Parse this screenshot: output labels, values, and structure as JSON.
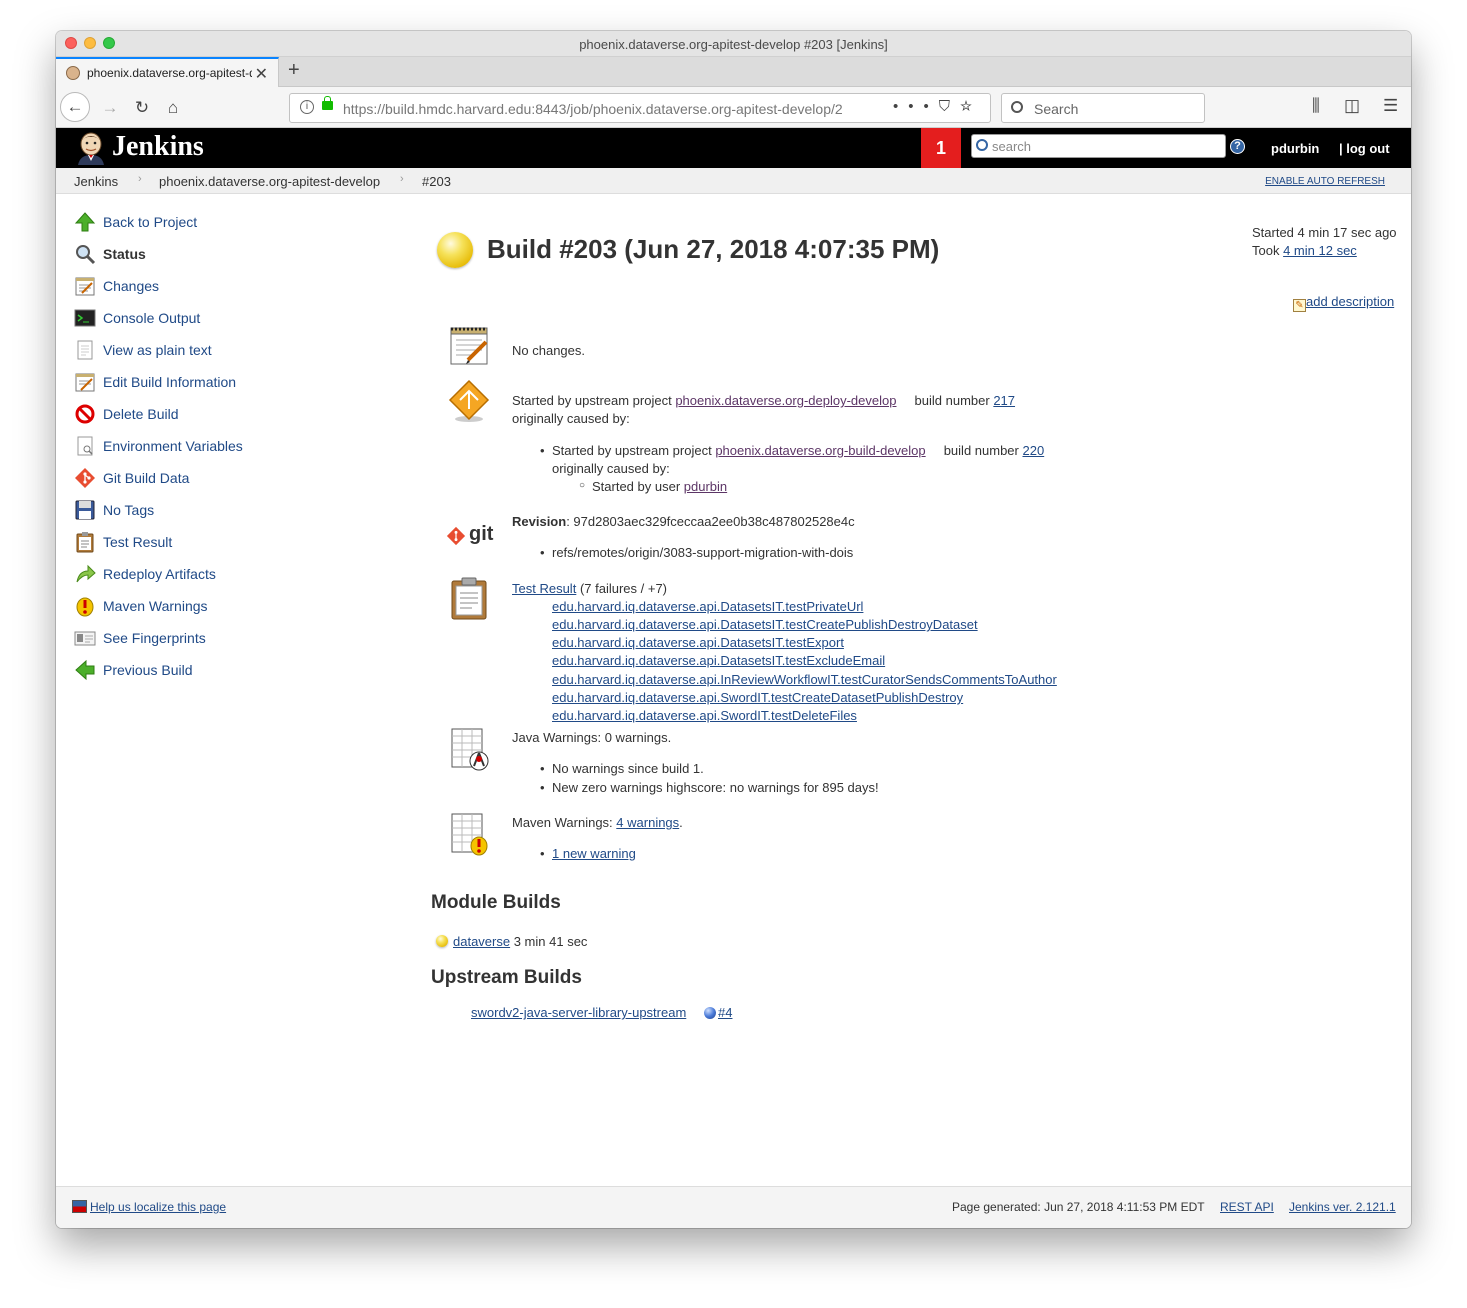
{
  "window": {
    "title": "phoenix.dataverse.org-apitest-develop #203 [Jenkins]"
  },
  "browser": {
    "tab_label": "phoenix.dataverse.org-apitest-d",
    "url": "https://build.hmdc.harvard.edu:8443/job/phoenix.dataverse.org-apitest-develop/2",
    "search_placeholder": "Search"
  },
  "jenkins": {
    "title": "Jenkins",
    "notification_count": "1",
    "search_placeholder": "search",
    "user": "pdurbin",
    "logout": "log out"
  },
  "breadcrumbs": {
    "items": [
      "Jenkins",
      "phoenix.dataverse.org-apitest-develop",
      "#203"
    ],
    "auto_refresh": "ENABLE AUTO REFRESH"
  },
  "sidebar": {
    "items": [
      {
        "label": "Back to Project",
        "icon": "up-arrow-icon"
      },
      {
        "label": "Status",
        "icon": "magnifier-icon"
      },
      {
        "label": "Changes",
        "icon": "notepad-icon"
      },
      {
        "label": "Console Output",
        "icon": "terminal-icon"
      },
      {
        "label": "View as plain text",
        "icon": "document-icon"
      },
      {
        "label": "Edit Build Information",
        "icon": "notepad-edit-icon"
      },
      {
        "label": "Delete Build",
        "icon": "no-entry-icon"
      },
      {
        "label": "Environment Variables",
        "icon": "document-search-icon"
      },
      {
        "label": "Git Build Data",
        "icon": "git-icon"
      },
      {
        "label": "No Tags",
        "icon": "floppy-icon"
      },
      {
        "label": "Test Result",
        "icon": "clipboard-icon"
      },
      {
        "label": "Redeploy Artifacts",
        "icon": "redeploy-arrow-icon"
      },
      {
        "label": "Maven Warnings",
        "icon": "warning-icon"
      },
      {
        "label": "See Fingerprints",
        "icon": "fingerprint-icon"
      },
      {
        "label": "Previous Build",
        "icon": "left-arrow-icon"
      }
    ]
  },
  "build": {
    "title": "Build #203 (Jun 27, 2018 4:07:35 PM)",
    "started": "Started 4 min 17 sec ago",
    "took_prefix": "Took",
    "took_link": "4 min 12 sec",
    "add_description": "add description",
    "status_color": "#f6e25a"
  },
  "changes": {
    "text": "No changes."
  },
  "cause": {
    "started_by_upstream": "Started by upstream project",
    "project": "phoenix.dataverse.org-deploy-develop",
    "build_number_label": "build number",
    "build_number": "217",
    "originally_caused_by": "originally caused by:",
    "nested_project": "phoenix.dataverse.org-build-develop",
    "nested_build_number": "220",
    "started_by_user": "Started by user",
    "user": "pdurbin"
  },
  "git": {
    "logo_text": "git",
    "revision_label": "Revision",
    "revision": ": 97d2803aec329fceccaa2ee0b38c487802528e4c",
    "ref": "refs/remotes/origin/3083-support-migration-with-dois"
  },
  "tests": {
    "link": "Test Result",
    "summary": "(7 failures / +7)",
    "failures": [
      "edu.harvard.iq.dataverse.api.DatasetsIT.testPrivateUrl",
      "edu.harvard.iq.dataverse.api.DatasetsIT.testCreatePublishDestroyDataset",
      "edu.harvard.iq.dataverse.api.DatasetsIT.testExport",
      "edu.harvard.iq.dataverse.api.DatasetsIT.testExcludeEmail",
      "edu.harvard.iq.dataverse.api.InReviewWorkflowIT.testCuratorSendsCommentsToAuthor",
      "edu.harvard.iq.dataverse.api.SwordIT.testCreateDatasetPublishDestroy",
      "edu.harvard.iq.dataverse.api.SwordIT.testDeleteFiles"
    ]
  },
  "java_warnings": {
    "text": "Java Warnings: 0 warnings.",
    "items": [
      "No warnings since build 1.",
      "New zero warnings highscore: no warnings for 895 days!"
    ]
  },
  "maven_warnings": {
    "prefix": "Maven Warnings:",
    "link": "4 warnings",
    "suffix": ".",
    "new_warning": "1 new warning"
  },
  "module_builds": {
    "heading": "Module Builds",
    "name": "dataverse",
    "duration": "3 min 41 sec"
  },
  "upstream_builds": {
    "heading": "Upstream Builds",
    "project": "swordv2-java-server-library-upstream",
    "build": "#4"
  },
  "footer": {
    "localize": "Help us localize this page",
    "generated": "Page generated: Jun 27, 2018 4:11:53 PM EDT",
    "rest_api": "REST API",
    "version": "Jenkins ver. 2.121.1"
  }
}
